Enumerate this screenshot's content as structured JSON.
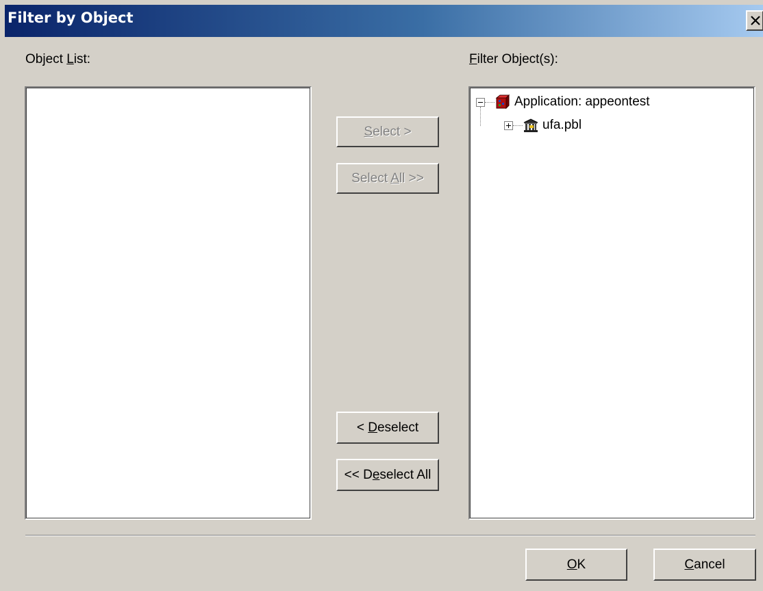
{
  "dialog": {
    "title": "Filter by Object",
    "close_glyph": "×"
  },
  "object_list": {
    "label_before": "Object ",
    "label_accel": "L",
    "label_after": "ist:",
    "items": []
  },
  "filter_objects": {
    "label_before": "",
    "label_accel": "F",
    "label_after": "ilter Object(s):",
    "tree": [
      {
        "label": "Application:  appeontest",
        "icon": "application-icon",
        "expander": "collapse",
        "level": 0
      },
      {
        "label": "ufa.pbl",
        "icon": "library-icon",
        "expander": "expand",
        "level": 1
      }
    ]
  },
  "buttons": {
    "select": {
      "before": "",
      "accel": "S",
      "after": "elect >",
      "enabled": false
    },
    "select_all": {
      "before": "Select ",
      "accel": "A",
      "after": "ll >>",
      "enabled": false
    },
    "deselect": {
      "before": "< ",
      "accel": "D",
      "after": "eselect",
      "enabled": true
    },
    "deselect_all": {
      "before": "<< D",
      "accel": "e",
      "after": "select All",
      "enabled": true
    },
    "ok": {
      "before": "",
      "accel": "O",
      "after": "K",
      "enabled": true
    },
    "cancel": {
      "before": "",
      "accel": "C",
      "after": "ancel",
      "enabled": true
    }
  },
  "colors": {
    "face": "#d4d0c8",
    "title_start": "#0a246a",
    "title_end": "#a6caf0",
    "disabled_text": "#808080"
  }
}
